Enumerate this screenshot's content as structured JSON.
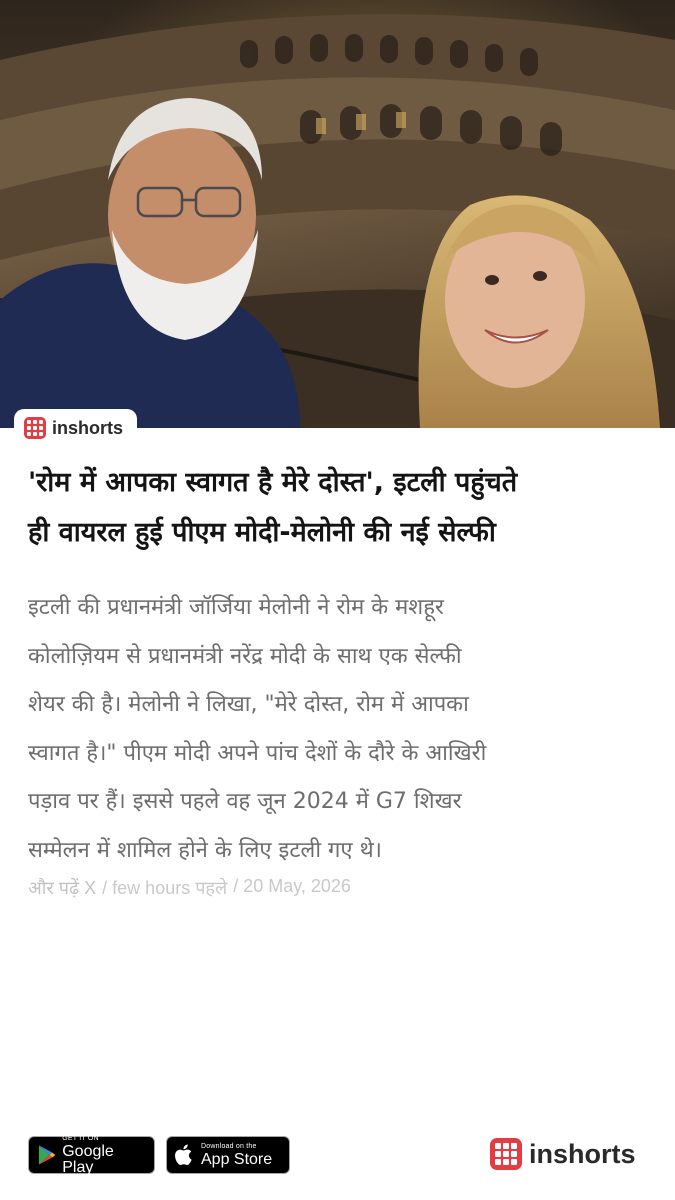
{
  "article": {
    "image_alt": "PM Modi and Giorgia Meloni selfie at the Colosseum, Rome",
    "headline_line1": "'रोम में आपका स्वागत है मेरे दोस्त', इटली पहुंचते",
    "headline_line2": "ही वायरल हुई पीएम मोदी-मेलोनी की नई सेल्फी",
    "summary_lines": [
      "इटली की प्रधानमंत्री जॉर्जिया मेलोनी ने रोम के मशहूर",
      "कोलोज़ियम से प्रधानमंत्री नरेंद्र मोदी के साथ एक सेल्फी",
      "शेयर की है। मेलोनी ने लिखा, \"मेरे दोस्त, रोम में आपका",
      "स्वागत है।\" पीएम मोदी अपने पांच देशों के दौरे के आखिरी",
      "पड़ाव पर हैं। इससे पहले वह जून 2024 में G7 शिखर",
      "सम्मेलन में शामिल होने के लिए इटली गए थे।"
    ],
    "meta": {
      "read_more": "और पढ़ें X",
      "time": "/ few hours पहले",
      "date": "/ 20 May, 2026"
    }
  },
  "brand": {
    "name": "inshorts",
    "accent": "#e33d43"
  },
  "footer": {
    "google_play_small": "GET IT ON",
    "google_play_big": "Google Play",
    "app_store_small": "Download on the",
    "app_store_big": "App Store",
    "logo_text": "inshorts"
  }
}
